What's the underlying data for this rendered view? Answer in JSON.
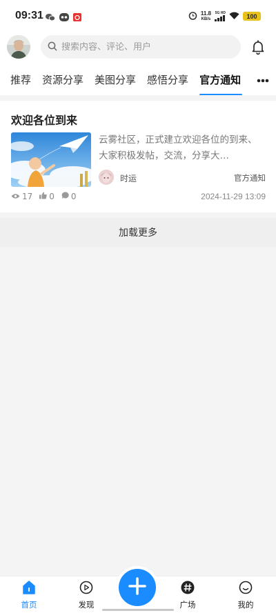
{
  "status_bar": {
    "time": "09:31",
    "net_speed_value": "11.8",
    "net_speed_unit": "KB/s",
    "network": "5G HD",
    "battery": "100"
  },
  "header": {
    "search_placeholder": "搜索内容、评论、用户"
  },
  "tabs": [
    {
      "label": "推荐"
    },
    {
      "label": "资源分享"
    },
    {
      "label": "美图分享"
    },
    {
      "label": "感悟分享"
    },
    {
      "label": "官方通知",
      "active": true
    }
  ],
  "post": {
    "title": "欢迎各位到来",
    "excerpt": "云雾社区，正式建立欢迎各位的到来、大家积极发帖，交流，分享大…",
    "author": "时运",
    "category": "官方通知",
    "views": "17",
    "likes": "0",
    "comments": "0",
    "date": "2024-11-29 13:09"
  },
  "load_more": "加载更多",
  "bottom_nav": {
    "home": "首页",
    "discover": "发现",
    "plaza": "广场",
    "mine": "我的"
  },
  "colors": {
    "accent": "#1a8cff"
  }
}
